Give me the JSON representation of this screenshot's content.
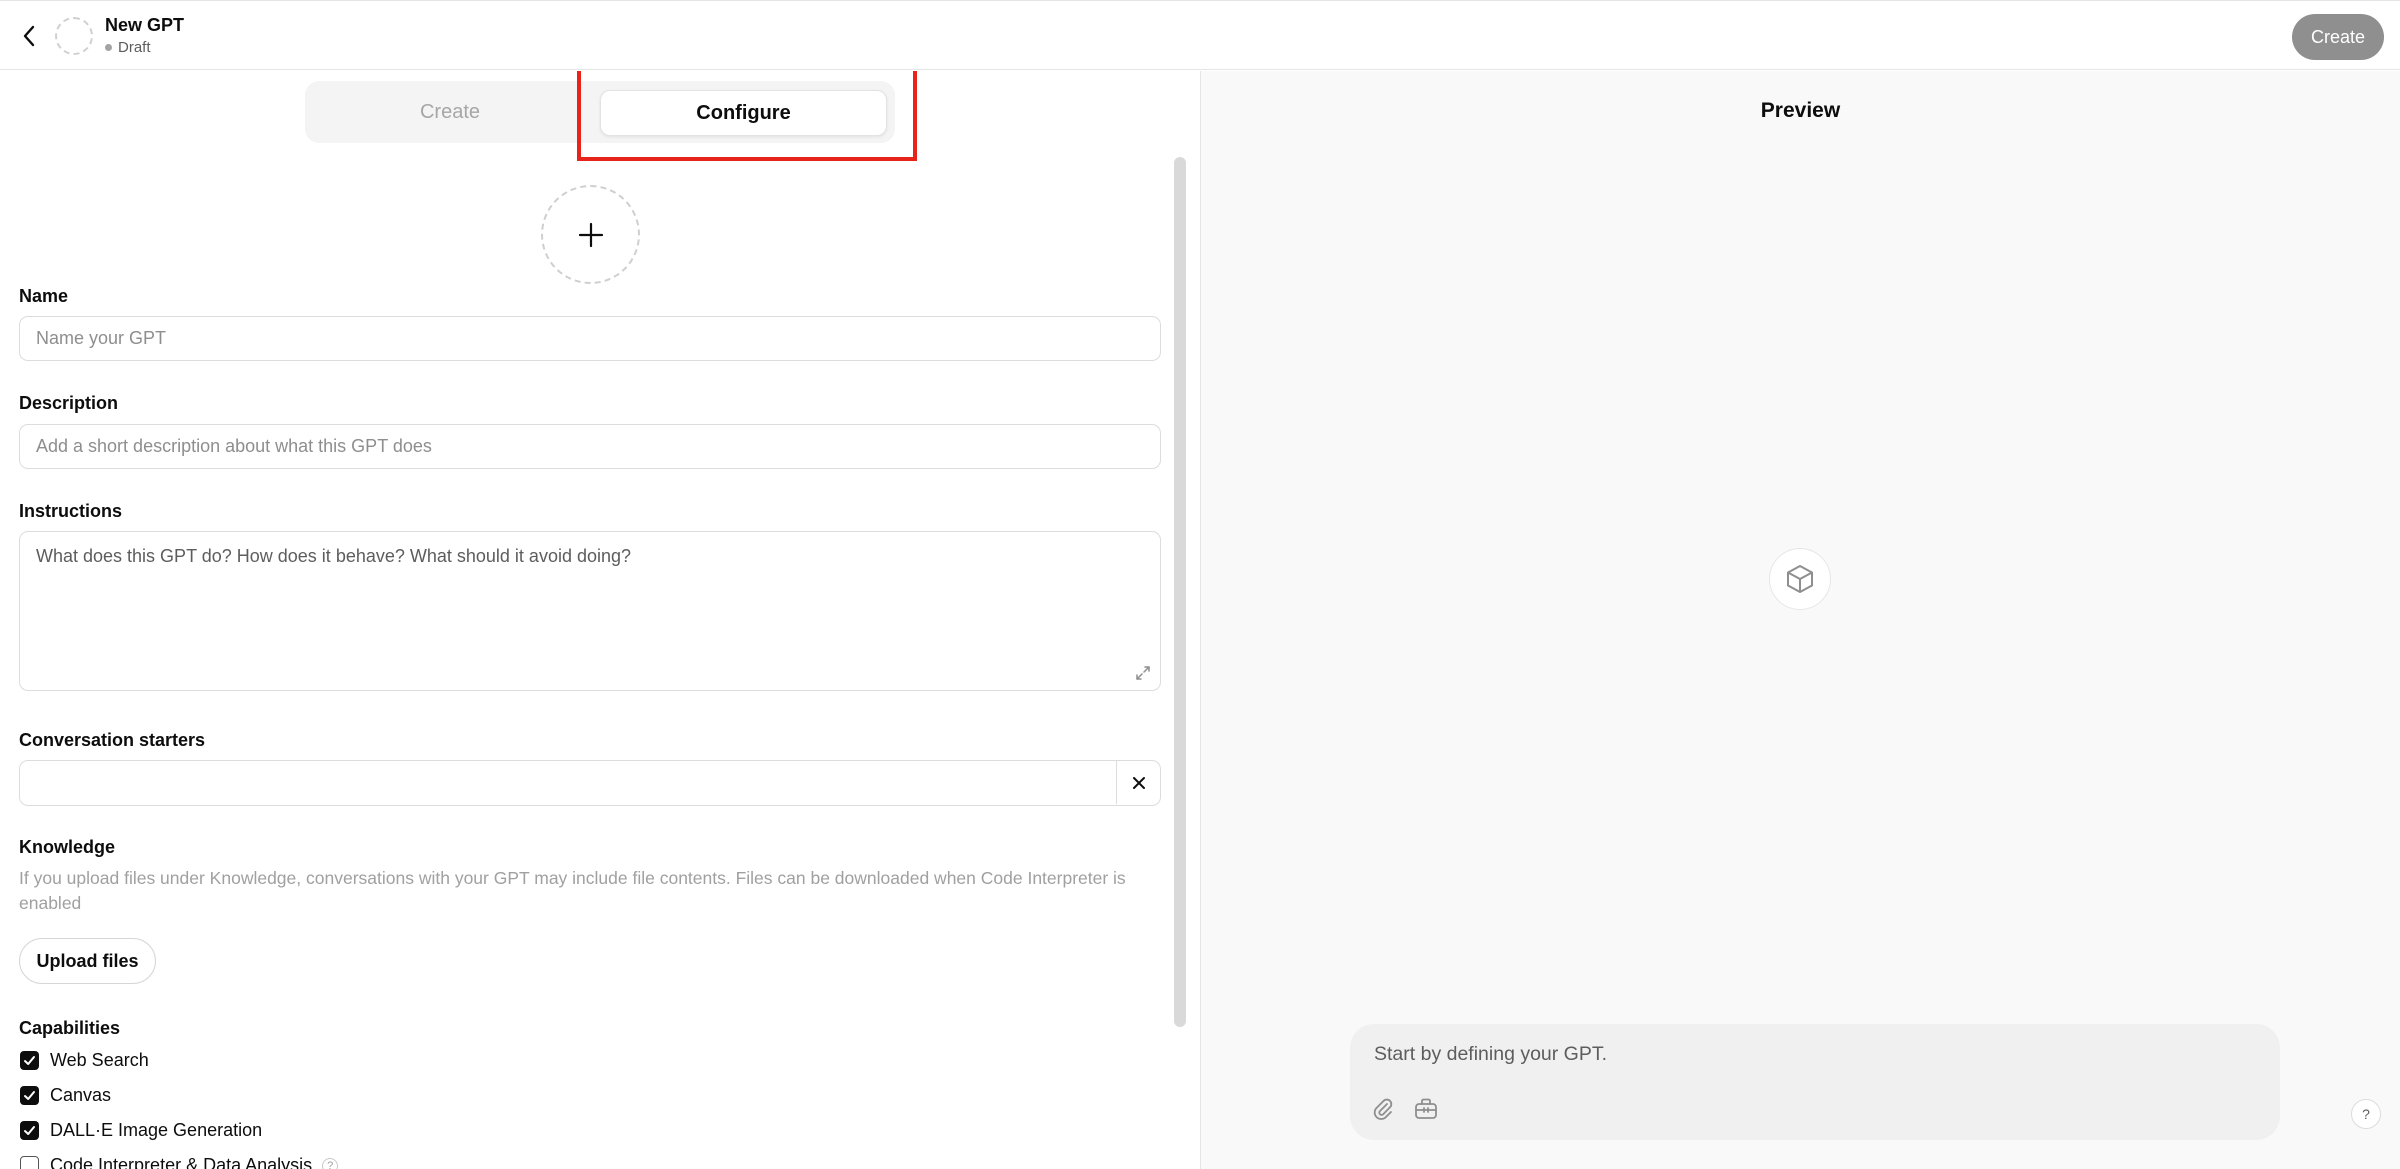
{
  "header": {
    "title": "New GPT",
    "status": "Draft",
    "create_label": "Create"
  },
  "tabs": {
    "create": "Create",
    "configure": "Configure",
    "active": "configure"
  },
  "form": {
    "name_label": "Name",
    "name_placeholder": "Name your GPT",
    "description_label": "Description",
    "description_placeholder": "Add a short description about what this GPT does",
    "instructions_label": "Instructions",
    "instructions_placeholder": "What does this GPT do? How does it behave? What should it avoid doing?",
    "starters_label": "Conversation starters",
    "starters_value": "",
    "knowledge_label": "Knowledge",
    "knowledge_desc": "If you upload files under Knowledge, conversations with your GPT may include file contents. Files can be downloaded when Code Interpreter is enabled",
    "upload_label": "Upload files",
    "capabilities_label": "Capabilities",
    "capabilities": [
      {
        "label": "Web Search",
        "checked": true
      },
      {
        "label": "Canvas",
        "checked": true
      },
      {
        "label": "DALL·E Image Generation",
        "checked": true
      },
      {
        "label": "Code Interpreter & Data Analysis",
        "checked": false
      }
    ]
  },
  "preview": {
    "title": "Preview",
    "composer_placeholder": "Start by defining your GPT.",
    "help": "?"
  },
  "colors": {
    "highlight": "#e8231a",
    "create_button": "#8f8f8f",
    "checkbox": "#0d0d0d"
  }
}
